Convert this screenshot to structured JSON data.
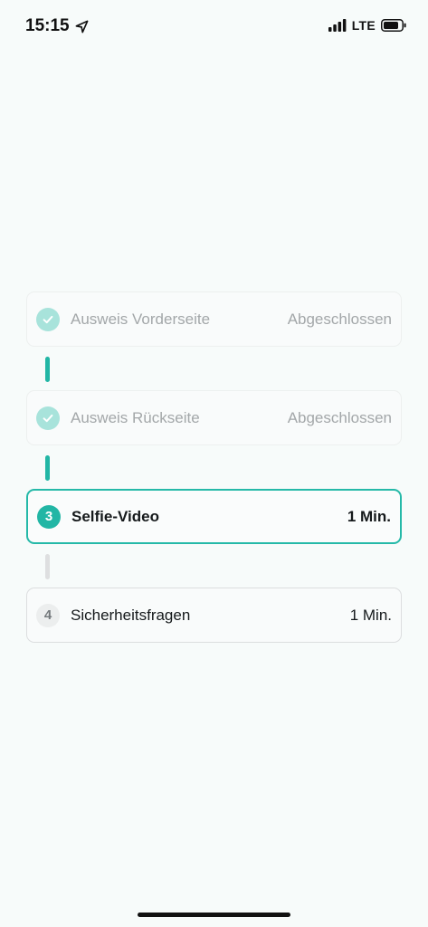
{
  "status_bar": {
    "time": "15:15",
    "network": "LTE",
    "icons": [
      "location-arrow-icon",
      "signal-bars-icon",
      "battery-icon"
    ]
  },
  "steps": [
    {
      "badge": "",
      "icon": "check-icon",
      "label": "Ausweis Vorderseite",
      "status": "Abgeschlossen",
      "state": "done"
    },
    {
      "badge": "",
      "icon": "check-icon",
      "label": "Ausweis Rückseite",
      "status": "Abgeschlossen",
      "state": "done"
    },
    {
      "badge": "3",
      "label": "Selfie-Video",
      "status": "1 Min.",
      "state": "active"
    },
    {
      "badge": "4",
      "label": "Sicherheitsfragen",
      "status": "1 Min.",
      "state": "pending"
    }
  ],
  "colors": {
    "accent": "#22b6a5",
    "accent_light": "#a8e3db",
    "background": "#f7fbfa",
    "text_primary": "#15191b",
    "text_muted": "#a3a7a9"
  }
}
